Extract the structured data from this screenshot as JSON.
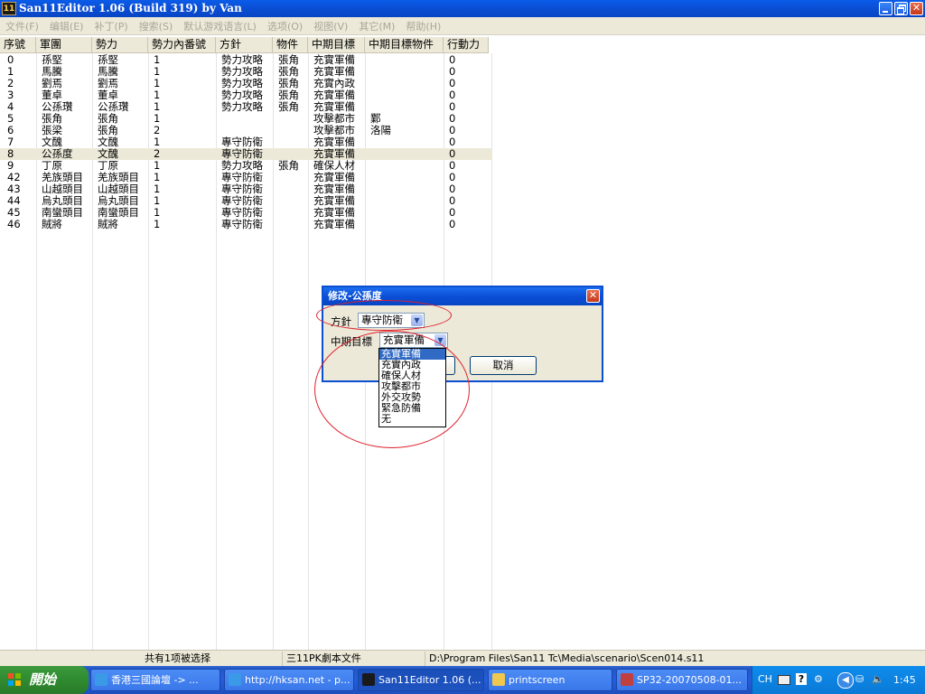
{
  "window": {
    "title": "San11Editor 1.06 (Build 319) by Van",
    "icon_text": "11"
  },
  "menu": [
    "文件(F)",
    "编辑(E)",
    "补丁(P)",
    "搜索(S)",
    "默认游戏语言(L)",
    "选项(O)",
    "视图(V)",
    "其它(M)",
    "帮助(H)"
  ],
  "columns": [
    "序號",
    "軍團",
    "勢力",
    "勢力內番號",
    "方針",
    "物件",
    "中期目標",
    "中期目標物件",
    "行動力"
  ],
  "rows": [
    [
      "0",
      "孫堅",
      "孫堅",
      "1",
      "勢力攻略",
      "張角",
      "充實軍備",
      "",
      "0"
    ],
    [
      "1",
      "馬騰",
      "馬騰",
      "1",
      "勢力攻略",
      "張角",
      "充實軍備",
      "",
      "0"
    ],
    [
      "2",
      "劉焉",
      "劉焉",
      "1",
      "勢力攻略",
      "張角",
      "充實內政",
      "",
      "0"
    ],
    [
      "3",
      "董卓",
      "董卓",
      "1",
      "勢力攻略",
      "張角",
      "充實軍備",
      "",
      "0"
    ],
    [
      "4",
      "公孫瓚",
      "公孫瓚",
      "1",
      "勢力攻略",
      "張角",
      "充實軍備",
      "",
      "0"
    ],
    [
      "5",
      "張角",
      "張角",
      "1",
      "",
      "",
      "攻擊都市",
      "鄴",
      "0"
    ],
    [
      "6",
      "張梁",
      "張角",
      "2",
      "",
      "",
      "攻擊都市",
      "洛陽",
      "0"
    ],
    [
      "7",
      "文醜",
      "文醜",
      "1",
      "專守防衛",
      "",
      "充實軍備",
      "",
      "0"
    ],
    [
      "8",
      "公孫度",
      "文醜",
      "2",
      "專守防衛",
      "",
      "充實軍備",
      "",
      "0"
    ],
    [
      "9",
      "丁原",
      "丁原",
      "1",
      "勢力攻略",
      "張角",
      "確保人材",
      "",
      "0"
    ],
    [
      "42",
      "羌族頭目",
      "羌族頭目",
      "1",
      "專守防衛",
      "",
      "充實軍備",
      "",
      "0"
    ],
    [
      "43",
      "山越頭目",
      "山越頭目",
      "1",
      "專守防衛",
      "",
      "充實軍備",
      "",
      "0"
    ],
    [
      "44",
      "烏丸頭目",
      "烏丸頭目",
      "1",
      "專守防衛",
      "",
      "充實軍備",
      "",
      "0"
    ],
    [
      "45",
      "南蠻頭目",
      "南蠻頭目",
      "1",
      "專守防衛",
      "",
      "充實軍備",
      "",
      "0"
    ],
    [
      "46",
      "賊將",
      "賊將",
      "1",
      "專守防衛",
      "",
      "充實軍備",
      "",
      "0"
    ]
  ],
  "selected_row": 8,
  "dialog": {
    "title": "修改-公孫度",
    "policy_label": "方針",
    "policy_value": "專守防衛",
    "goal_label": "中期目標",
    "goal_value": "充實軍備",
    "cancel_label": "取消",
    "goal_options": [
      "充實軍備",
      "充實內政",
      "確保人材",
      "攻擊都市",
      "外交攻勢",
      "緊急防備",
      "无"
    ],
    "highlighted_option": 0
  },
  "status": {
    "selection": "共有1项被选择",
    "filetype": "三11PK劇本文件",
    "path": "D:\\Program Files\\San11 Tc\\Media\\scenario\\Scen014.s11"
  },
  "taskbar": {
    "start_label": "開始",
    "tasks": [
      "香港三國論壇 -> ...",
      "http://hksan.net - p...",
      "San11Editor 1.06 (...",
      "printscreen",
      "SP32-20070508-01..."
    ],
    "active_task": 2,
    "tray_lang": "CH",
    "clock": "1:45"
  },
  "colors": {
    "accent": "#0a4fd0",
    "annotation": "#e0202c",
    "selection": "#316ac5"
  }
}
